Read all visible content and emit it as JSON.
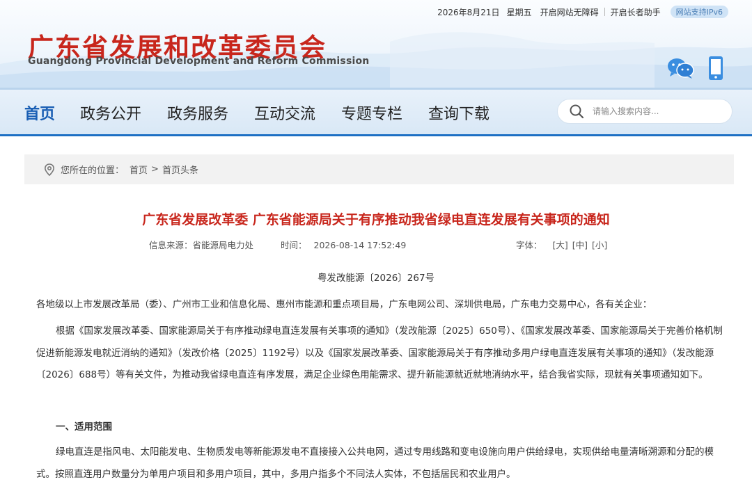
{
  "topbar": {
    "date": "2026年8月21日",
    "weekday": "星期五",
    "accessibility": "开启网站无障碍",
    "elder_mode": "开启长者助手",
    "ipv6": "网站支持IPv6"
  },
  "logo": {
    "cn": "广东省发展和改革委员会",
    "en": "Guangdong Provincial Development and Reform Commission"
  },
  "nav": {
    "items": [
      "首页",
      "政务公开",
      "政务服务",
      "互动交流",
      "专题专栏",
      "查询下载"
    ],
    "active_index": 0
  },
  "search": {
    "placeholder": "请输入搜索内容..."
  },
  "breadcrumb": {
    "prefix": "您所在的位置：",
    "items": [
      "首页",
      "首页头条"
    ],
    "separator": ">"
  },
  "article": {
    "title": "广东省发展改革委 广东省能源局关于有序推动我省绿电直连发展有关事项的通知",
    "source_label": "信息来源：",
    "source": "省能源局电力处",
    "time_label": "时间：",
    "time": "2026-08-14 17:52:49",
    "fontsize_label": "字体：",
    "fontsize_options": [
      "[大]",
      "[中]",
      "[小]"
    ],
    "doc_number": "粤发改能源〔2026〕267号",
    "recipients": "各地级以上市发展改革局（委）、广州市工业和信息化局、惠州市能源和重点项目局，广东电网公司、深圳供电局，广东电力交易中心，各有关企业：",
    "intro": "根据《国家发展改革委、国家能源局关于有序推动绿电直连发展有关事项的通知》（发改能源〔2025〕650号）、《国家发展改革委、国家能源局关于完善价格机制促进新能源发电就近消纳的通知》（发改价格〔2025〕1192号）以及《国家发展改革委、国家能源局关于有序推动多用户绿电直连发展有关事项的通知》（发改能源〔2026〕688号）等有关文件，为推动我省绿电直连有序发展，满足企业绿色用能需求、提升新能源就近就地消纳水平，结合我省实际，现就有关事项通知如下。",
    "section1_heading": "一、适用范围",
    "section1_body": "绿电直连是指风电、太阳能发电、生物质发电等新能源发电不直接接入公共电网，通过专用线路和变电设施向用户供给绿电，实现供给电量清晰溯源和分配的模式。按照直连用户数量分为单用户项目和多用户项目，其中，多用户指多个不同法人实体，不包括居民和农业用户。"
  },
  "colors": {
    "brand_red": "#c8261c",
    "nav_active": "#1a5fb4",
    "nav_underline": "#1d6fc4",
    "ipv6_badge_bg": "#cfe3f6"
  },
  "icons": {
    "wechat": "wechat-icon",
    "mobile": "mobile-icon",
    "search": "search-icon",
    "location": "location-pin-icon"
  }
}
